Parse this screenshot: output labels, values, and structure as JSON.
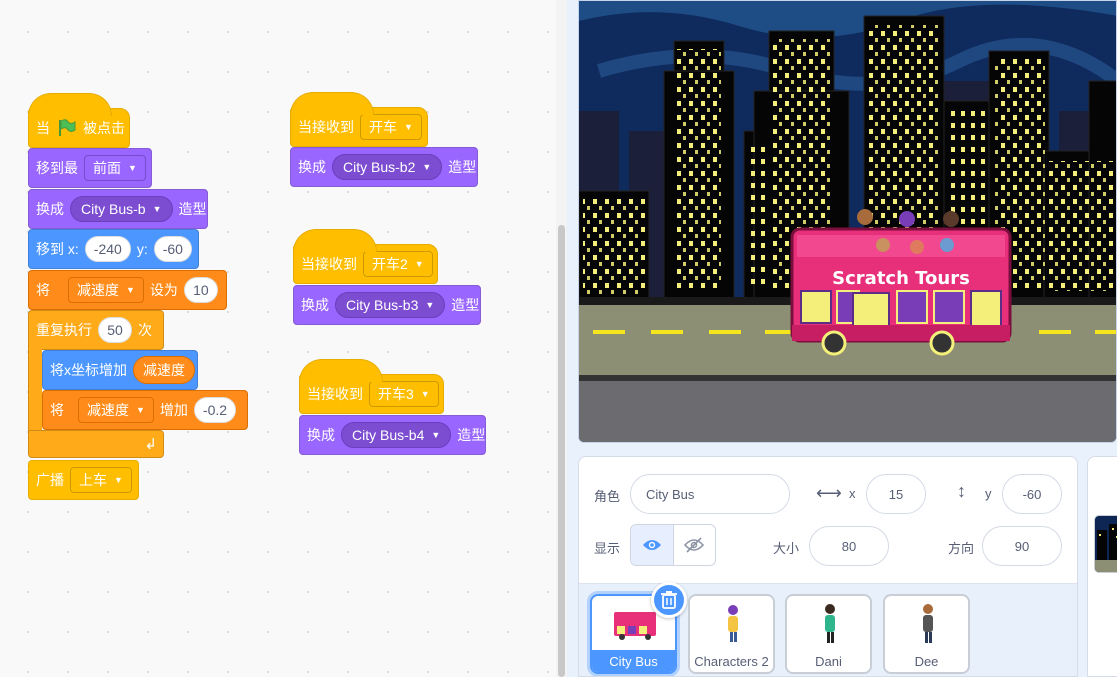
{
  "script_when_flag": {
    "hat_prefix": "当",
    "hat_suffix": "被点击",
    "go_to_front": {
      "label": "移到最",
      "option": "前面"
    },
    "switch_costume": {
      "label": "换成",
      "costume": "City Bus-b",
      "suffix": "造型"
    },
    "go_to_xy": {
      "label_x": "移到 x:",
      "x": "-240",
      "label_y": "y:",
      "y": "-60"
    },
    "set_var": {
      "label": "将",
      "var": "减速度",
      "mid": "设为",
      "value": "10"
    },
    "repeat": {
      "label": "重复执行",
      "times": "50",
      "suffix": "次"
    },
    "change_x": {
      "label": "将x坐标增加",
      "reporter": "减速度"
    },
    "change_var": {
      "label": "将",
      "var": "减速度",
      "mid": "增加",
      "value": "-0.2"
    },
    "broadcast": {
      "label": "广播",
      "message": "上车"
    }
  },
  "script_recv1": {
    "hat": "当接收到",
    "message": "开车",
    "label": "换成",
    "costume": "City Bus-b2",
    "suffix": "造型"
  },
  "script_recv2": {
    "hat": "当接收到",
    "message": "开车2",
    "label": "换成",
    "costume": "City Bus-b3",
    "suffix": "造型"
  },
  "script_recv3": {
    "hat": "当接收到",
    "message": "开车3",
    "label": "换成",
    "costume": "City Bus-b4",
    "suffix": "造型"
  },
  "stage": {
    "bus_sign": "Scratch Tours"
  },
  "sprite_info": {
    "sprite_label": "角色",
    "sprite_name": "City Bus",
    "x_label": "x",
    "x": "15",
    "y_label": "y",
    "y": "-60",
    "show_label": "显示",
    "size_label": "大小",
    "size": "80",
    "direction_label": "方向",
    "direction": "90"
  },
  "sprites": [
    {
      "name": "City Bus",
      "selected": true
    },
    {
      "name": "Characters 2",
      "selected": false
    },
    {
      "name": "Dani",
      "selected": false
    },
    {
      "name": "Dee",
      "selected": false
    }
  ],
  "colors": {
    "events": "#ffbf00",
    "looks": "#9966ff",
    "motion": "#4c97ff",
    "variables": "#ff8c1a",
    "control": "#ffab19",
    "accent": "#4c97ff"
  }
}
